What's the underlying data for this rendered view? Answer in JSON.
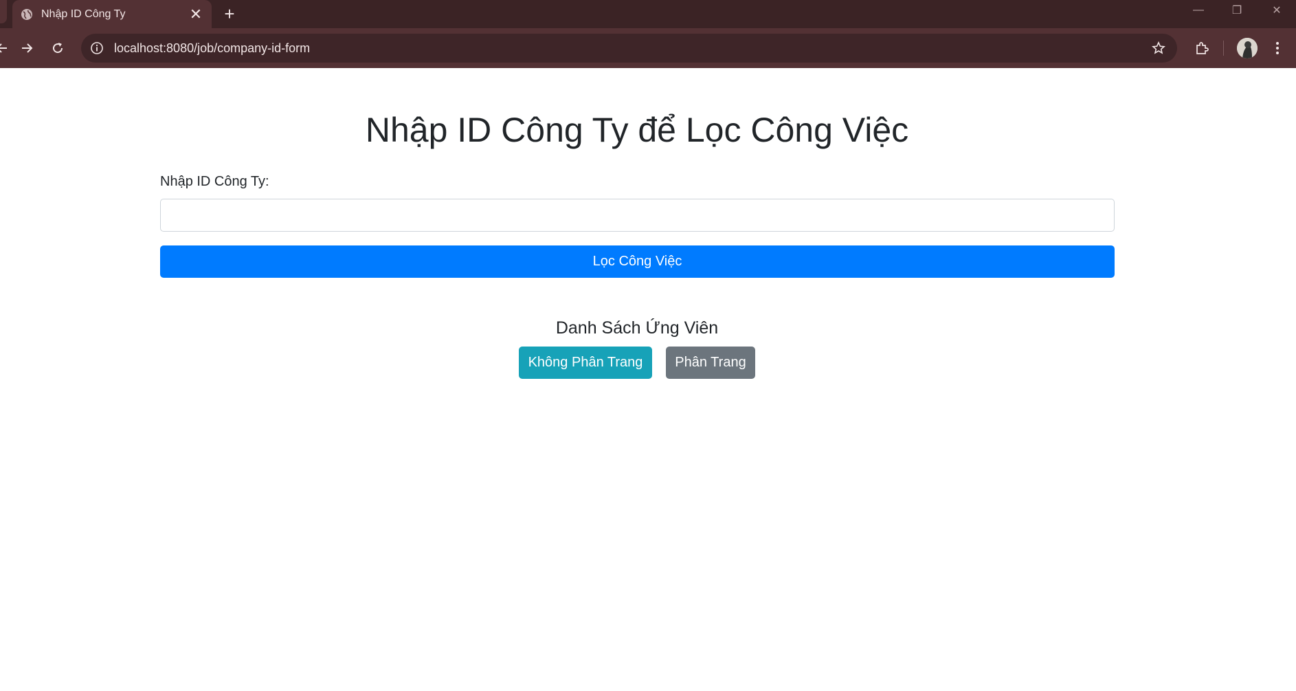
{
  "browser": {
    "tab_title": "Nhập ID Công Ty",
    "tab_close_glyph": "✕",
    "new_tab_glyph": "+",
    "url": "localhost:8080/job/company-id-form",
    "window_controls": {
      "minimize": "—",
      "restore": "❐",
      "close": "✕"
    },
    "colors": {
      "frame": "#3b2325",
      "toolbar": "#533134",
      "omnibox": "#3e2528"
    }
  },
  "page": {
    "heading": "Nhập ID Công Ty để Lọc Công Việc",
    "company_id_label": "Nhập ID Công Ty:",
    "company_id_value": "",
    "filter_button_label": "Lọc Công Việc",
    "candidates_title": "Danh Sách Ứng Viên",
    "no_pagination_button_label": "Không Phân Trang",
    "pagination_button_label": "Phân Trang",
    "colors": {
      "primary": "#007bff",
      "info": "#17a2b8",
      "secondary": "#6c757d",
      "text": "#212529"
    }
  }
}
